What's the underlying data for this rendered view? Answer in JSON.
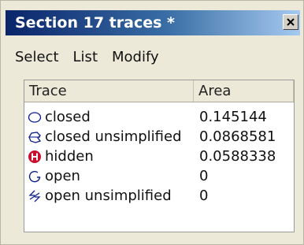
{
  "window": {
    "title": "Section 17 traces *",
    "close_glyph": "×"
  },
  "menu": {
    "items": [
      {
        "label": "Select"
      },
      {
        "label": "List"
      },
      {
        "label": "Modify"
      }
    ]
  },
  "table": {
    "columns": [
      "Trace",
      "Area"
    ],
    "rows": [
      {
        "name": "closed",
        "area": "0.145144",
        "icon": "closed-trace-icon"
      },
      {
        "name": "closed unsimplified",
        "area": "0.0868581",
        "icon": "closed-unsimplified-trace-icon"
      },
      {
        "name": "hidden",
        "area": "0.0588338",
        "icon": "hidden-trace-icon",
        "icon_color": "#c8102e"
      },
      {
        "name": "open",
        "area": "0",
        "icon": "open-trace-icon"
      },
      {
        "name": "open unsimplified",
        "area": "0",
        "icon": "open-unsimplified-trace-icon"
      }
    ]
  },
  "colors": {
    "titlebar_start": "#0a246a",
    "titlebar_end": "#a6caf0",
    "icon_stroke": "#0b1e8c",
    "hidden_icon": "#c8102e"
  }
}
